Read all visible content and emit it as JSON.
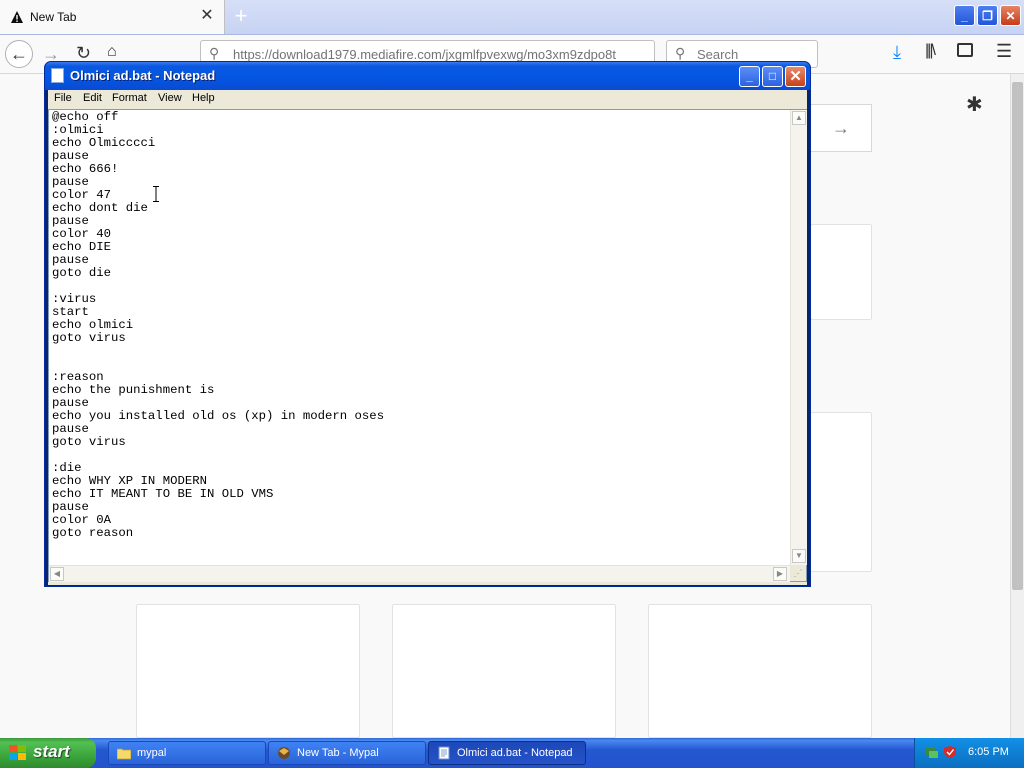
{
  "browser": {
    "tab": {
      "title": "New Tab"
    },
    "url": "https://download1979.mediafire.com/jxgmlfpvexwg/mo3xm9zdpo8t",
    "search_placeholder": "Search",
    "colors": {
      "download_accent": "#0a84ff"
    }
  },
  "notepad": {
    "title": "Olmici ad.bat - Notepad",
    "menu": [
      "File",
      "Edit",
      "Format",
      "View",
      "Help"
    ],
    "content": "@echo off\n:olmici\necho Olmicccci\npause\necho 666!\npause\ncolor 47\necho dont die\npause\ncolor 40\necho DIE\npause\ngoto die\n\n:virus\nstart\necho olmici\ngoto virus\n\n\n:reason\necho the punishment is\npause\necho you installed old os (xp) in modern oses\npause\ngoto virus\n\n:die\necho WHY XP IN MODERN\necho IT MEANT TO BE IN OLD VMS\npause\ncolor 0A\ngoto reason"
  },
  "taskbar": {
    "start_label": "start",
    "tasks": [
      {
        "label": "mypal",
        "icon": "folder-icon"
      },
      {
        "label": "New Tab - Mypal",
        "icon": "mypal-icon"
      },
      {
        "label": "Olmici ad.bat - Notepad",
        "icon": "notepad-icon"
      }
    ],
    "clock": "6:05 PM"
  }
}
